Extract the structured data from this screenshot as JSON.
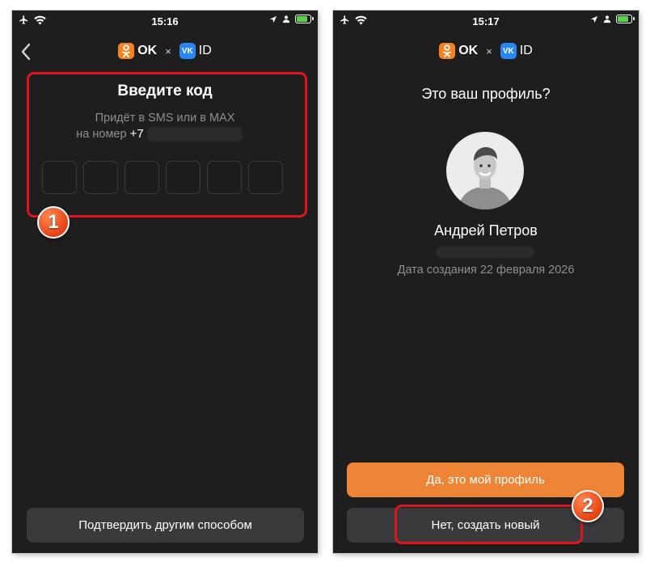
{
  "status_left": {
    "time": "15:16"
  },
  "status_right": {
    "time": "15:17"
  },
  "brand": {
    "ok_label": "OK",
    "separator": "×",
    "vk_badge": "VK",
    "vkid_label": "ID",
    "ok_color": "#f58220",
    "vk_color": "#2787f5"
  },
  "code_screen": {
    "title": "Введите код",
    "subtitle_line1": "Придёт в SMS или в MAX",
    "subtitle_line2_prefix": "на номер",
    "phone_prefix": "+7",
    "code_cells": [
      "",
      "",
      "",
      "",
      "",
      ""
    ],
    "alt_button": "Подтвердить другим способом"
  },
  "profile_screen": {
    "question": "Это ваш профиль?",
    "name": "Андрей Петров",
    "created": "Дата создания 22 февраля 2026",
    "confirm_button": "Да, это мой профиль",
    "new_button": "Нет, создать новый",
    "accent_color": "#ee8536"
  },
  "annotations": {
    "step1": "1",
    "step2": "2",
    "frame_color": "#e0141a"
  }
}
